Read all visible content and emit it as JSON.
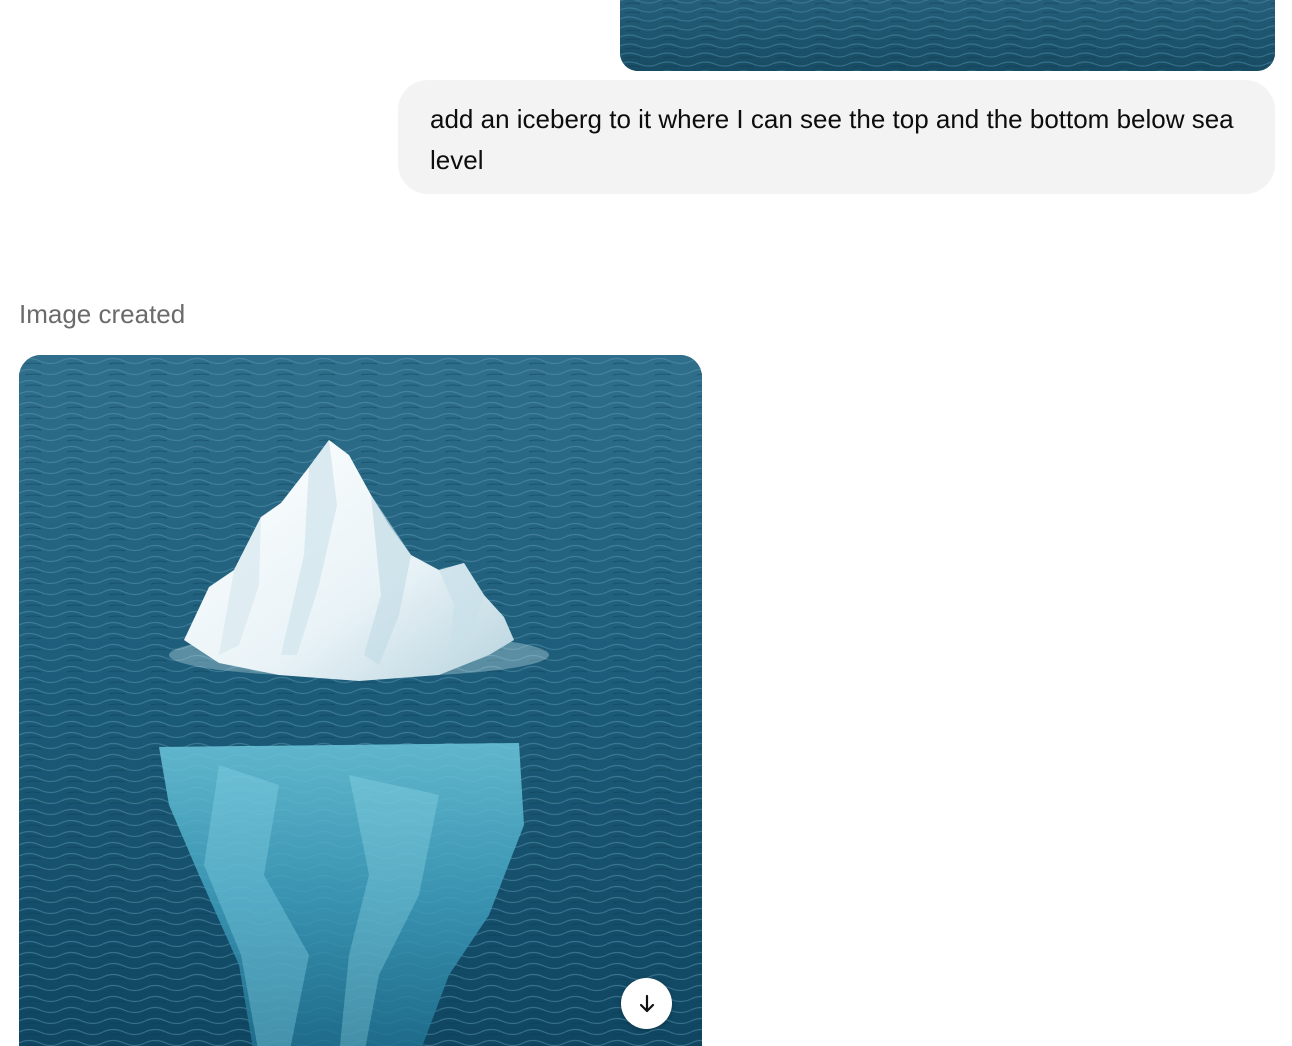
{
  "conversation": {
    "previous_image": {
      "icon": "ocean-image"
    },
    "user_message": {
      "text": "add an iceberg to it where I can see the top and the bottom below sea level"
    },
    "assistant": {
      "status_label": "Image created",
      "generated_image": {
        "icon": "iceberg-image"
      },
      "download_button": {
        "icon": "arrow-down-icon"
      }
    }
  },
  "colors": {
    "bubble_background": "#f3f3f3",
    "status_text": "#6b6b6b",
    "ocean": "#1f5a75"
  }
}
